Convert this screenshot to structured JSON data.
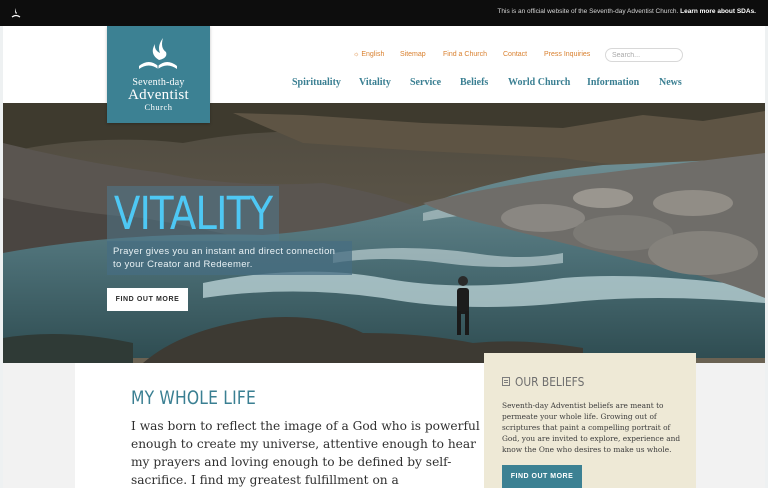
{
  "topbar": {
    "official_text": "This is an official website of the Seventh-day Adventist Church.",
    "learn_more_label": "Learn more about SDAs."
  },
  "logo": {
    "line1": "Seventh-day",
    "line2": "Adventist",
    "line3": "Church"
  },
  "utility_nav": {
    "language": "English",
    "items": [
      "Sitemap",
      "Find a Church",
      "Contact",
      "Press Inquiries"
    ]
  },
  "search": {
    "placeholder": "Search..."
  },
  "main_nav": {
    "items": [
      "Spirituality",
      "Vitality",
      "Service",
      "Beliefs",
      "World Church",
      "Information",
      "News"
    ]
  },
  "hero": {
    "title": "VITALITY",
    "text": "Prayer gives you an instant and direct connection to your Creator and Redeemer.",
    "button_label": "FIND OUT MORE"
  },
  "content": {
    "title": "MY WHOLE LIFE",
    "text": "I was born to reflect the image of a God who is powerful enough to create my universe,  attentive enough to hear my prayers and loving enough to be defined by self-sacrifice.  I find my greatest fulfillment on a"
  },
  "beliefs": {
    "title": "OUR BELIEFS",
    "text": "Seventh-day Adventist beliefs are meant to permeate your whole life. Growing out of scriptures that paint a compelling portrait of God, you are invited to explore, experience and know the One who desires to make us whole.",
    "button_label": "FIND OUT MORE"
  },
  "colors": {
    "brand_teal": "#3c8193",
    "nav_text": "#3a7f92",
    "utility_orange": "#d9802f",
    "hero_title": "#4ec8f4",
    "beliefs_bg": "#eee9d6",
    "topbar_bg": "#0d0d0d"
  },
  "icons": [
    "church-mini-logo-icon",
    "flame-book-logo-icon",
    "globe-icon",
    "document-icon"
  ]
}
